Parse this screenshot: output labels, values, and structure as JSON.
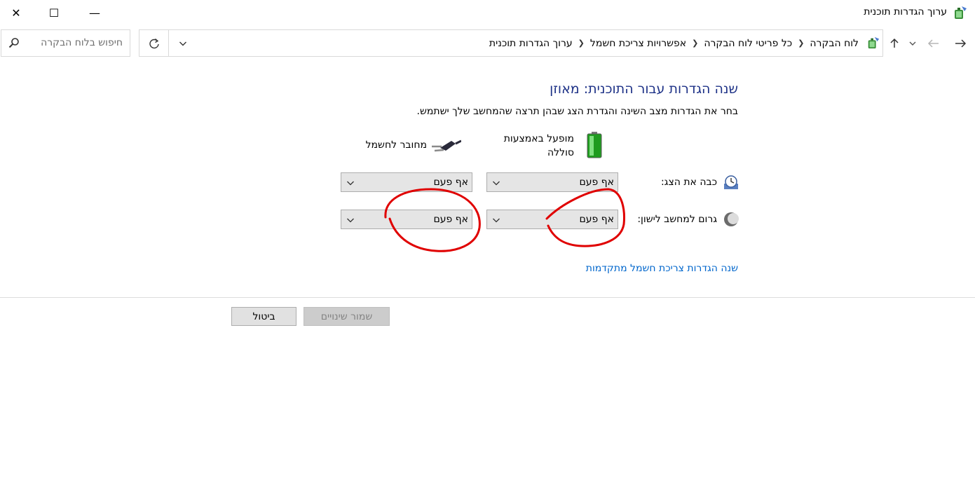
{
  "window": {
    "title": "ערוך הגדרות תוכנית",
    "close_glyph": "✕",
    "maximize_glyph": "☐",
    "minimize_glyph": "—"
  },
  "search": {
    "placeholder": "חיפוש בלוח הבקרה",
    "value": ""
  },
  "address": {
    "breadcrumb": [
      "לוח הבקרה",
      "כל פריטי לוח הבקרה",
      "אפשרויות צריכת חשמל",
      "ערוך הגדרות תוכנית"
    ],
    "separator": "❯"
  },
  "content": {
    "title": "שנה הגדרות עבור התוכנית: מאוזן",
    "description": "בחר את הגדרות מצב השינה והגדרת הצג שבהן תרצה שהמחשב שלך ישתמש.",
    "on_battery_label": "מופעל באמצעות סוללה",
    "plugged_in_label": "מחובר לחשמל",
    "rows": [
      {
        "label": "כבה את הצג:",
        "on_battery": "אף פעם",
        "plugged_in": "אף פעם"
      },
      {
        "label": "גרום למחשב לישון:",
        "on_battery": "אף פעם",
        "plugged_in": "אף פעם"
      }
    ],
    "advanced_link": "שנה הגדרות צריכת חשמל מתקדמות"
  },
  "buttons": {
    "save": "שמור שינויים",
    "cancel": "ביטול"
  },
  "icons": {
    "title": "power-options-icon",
    "search": "magnifier-icon",
    "refresh": "refresh-icon",
    "battery": "battery-icon",
    "plug": "power-plug-icon",
    "display": "display-clock-icon",
    "sleep": "moon-icon"
  },
  "colors": {
    "title_blue": "#1e3287",
    "link_blue": "#0066cc",
    "annotation_red": "#e00000",
    "battery_green": "#2fb62f"
  }
}
